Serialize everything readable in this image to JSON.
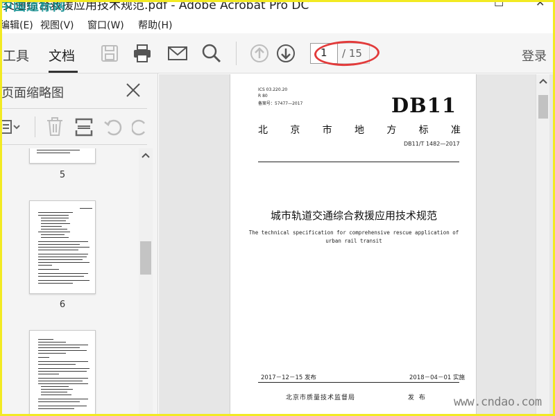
{
  "window": {
    "title": "交通综合救援应用技术规范.pdf - Adobe Acrobat Pro DC",
    "minimize_glyph": "—",
    "maximize_glyph": "☐",
    "close_glyph": "✕"
  },
  "watermark_top": "中国道标网",
  "menu": {
    "items": [
      "编辑(E)",
      "视图(V)",
      "窗口(W)",
      "帮助(H)"
    ]
  },
  "toolbar": {
    "tab_tools": "工具",
    "tab_document": "文档",
    "icons": [
      "save-icon",
      "print-icon",
      "mail-icon",
      "search-icon",
      "page-up-icon",
      "page-down-icon"
    ],
    "page_current": "1",
    "page_total": "/ 15",
    "login": "登录"
  },
  "left_panel": {
    "title": "页面缩略图",
    "thumbnails": [
      {
        "label": "5"
      },
      {
        "label": "6"
      }
    ]
  },
  "document": {
    "ics": "ICS 03.220.20",
    "r_code": "R 80",
    "filing": "备案号：57477—2017",
    "db_code": "DB11",
    "std_region_chars": [
      "北",
      "京",
      "市",
      "地",
      "方",
      "标",
      "准"
    ],
    "std_number": "DB11/T 1482—2017",
    "title_cn": "城市轨道交通综合救援应用技术规范",
    "title_en_line1": "The technical specification for comprehensive rescue application of",
    "title_en_line2": "urban rail transit",
    "date_issue": "2017－12－15 发布",
    "date_implement": "2018－04－01 实施",
    "issuer": "北京市质量技术监督局",
    "publish": "发 布"
  },
  "watermark_bottom": "www.cndao.com",
  "colors": {
    "frame": "#f2ea22",
    "annotation_ellipse": "#e23b3b",
    "watermark_top": "#0a8d8f"
  }
}
